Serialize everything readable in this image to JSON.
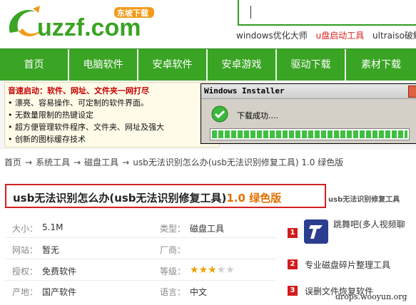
{
  "logo": {
    "text": "uzzf.com",
    "badge": "东坡下载"
  },
  "search": {
    "placeholder": ""
  },
  "hotwords": [
    "windows优化大师",
    "u盘启动工具",
    "ultraiso破解"
  ],
  "nav": [
    "首页",
    "电脑软件",
    "安卓软件",
    "安卓游戏",
    "驱动下载",
    "素材下载"
  ],
  "ad": {
    "headline": "音速启动：软件、网址、文件夹一网打尽",
    "lines": [
      "• 漂亮、容易操作、可定制的软件界面。",
      "• 无数量限制的热键设定",
      "• 超方便管理软件程序、文件夹、网址及强大",
      "• 创新的图标缓存技术"
    ]
  },
  "installer": {
    "title": "Windows Installer",
    "message": "下载成功....",
    "progress": 1.0,
    "accent": "#3fc040"
  },
  "breadcrumb": [
    "首页",
    "系统工具",
    "磁盘工具",
    "usb无法识别怎么办(usb无法识别修复工具) 1.0 绿色版"
  ],
  "title": {
    "name": "usb无法识别怎么办(usb无法识别修复工具)",
    "version": "1.0 绿色版",
    "sub": "usb无法识别修复工具"
  },
  "info": {
    "size_label": "大小：",
    "size": "5.1M",
    "type_label": "类型：",
    "type": "磁盘工具",
    "site_label": "网站：",
    "site": "暂无",
    "vendor_label": "厂商：",
    "vendor": "",
    "license_label": "授权：",
    "license": "免费软件",
    "grade_label": "等级：",
    "rating": 3,
    "rating_max": 5,
    "origin_label": "产地：",
    "origin": "国产软件",
    "lang_label": "语言：",
    "lang": "中文"
  },
  "related": [
    {
      "num": "1",
      "text": "跳舞吧(多人视频聊"
    },
    {
      "num": "2",
      "text": "专业磁盘碎片整理工具"
    },
    {
      "num": "3",
      "text": "误删文件恢复软件"
    }
  ],
  "watermark": "drops.wooyun.org",
  "colors": {
    "brand_green": "#3aa424",
    "title_border": "#d22020",
    "version_orange": "#e07000",
    "star": "#f0a000"
  }
}
